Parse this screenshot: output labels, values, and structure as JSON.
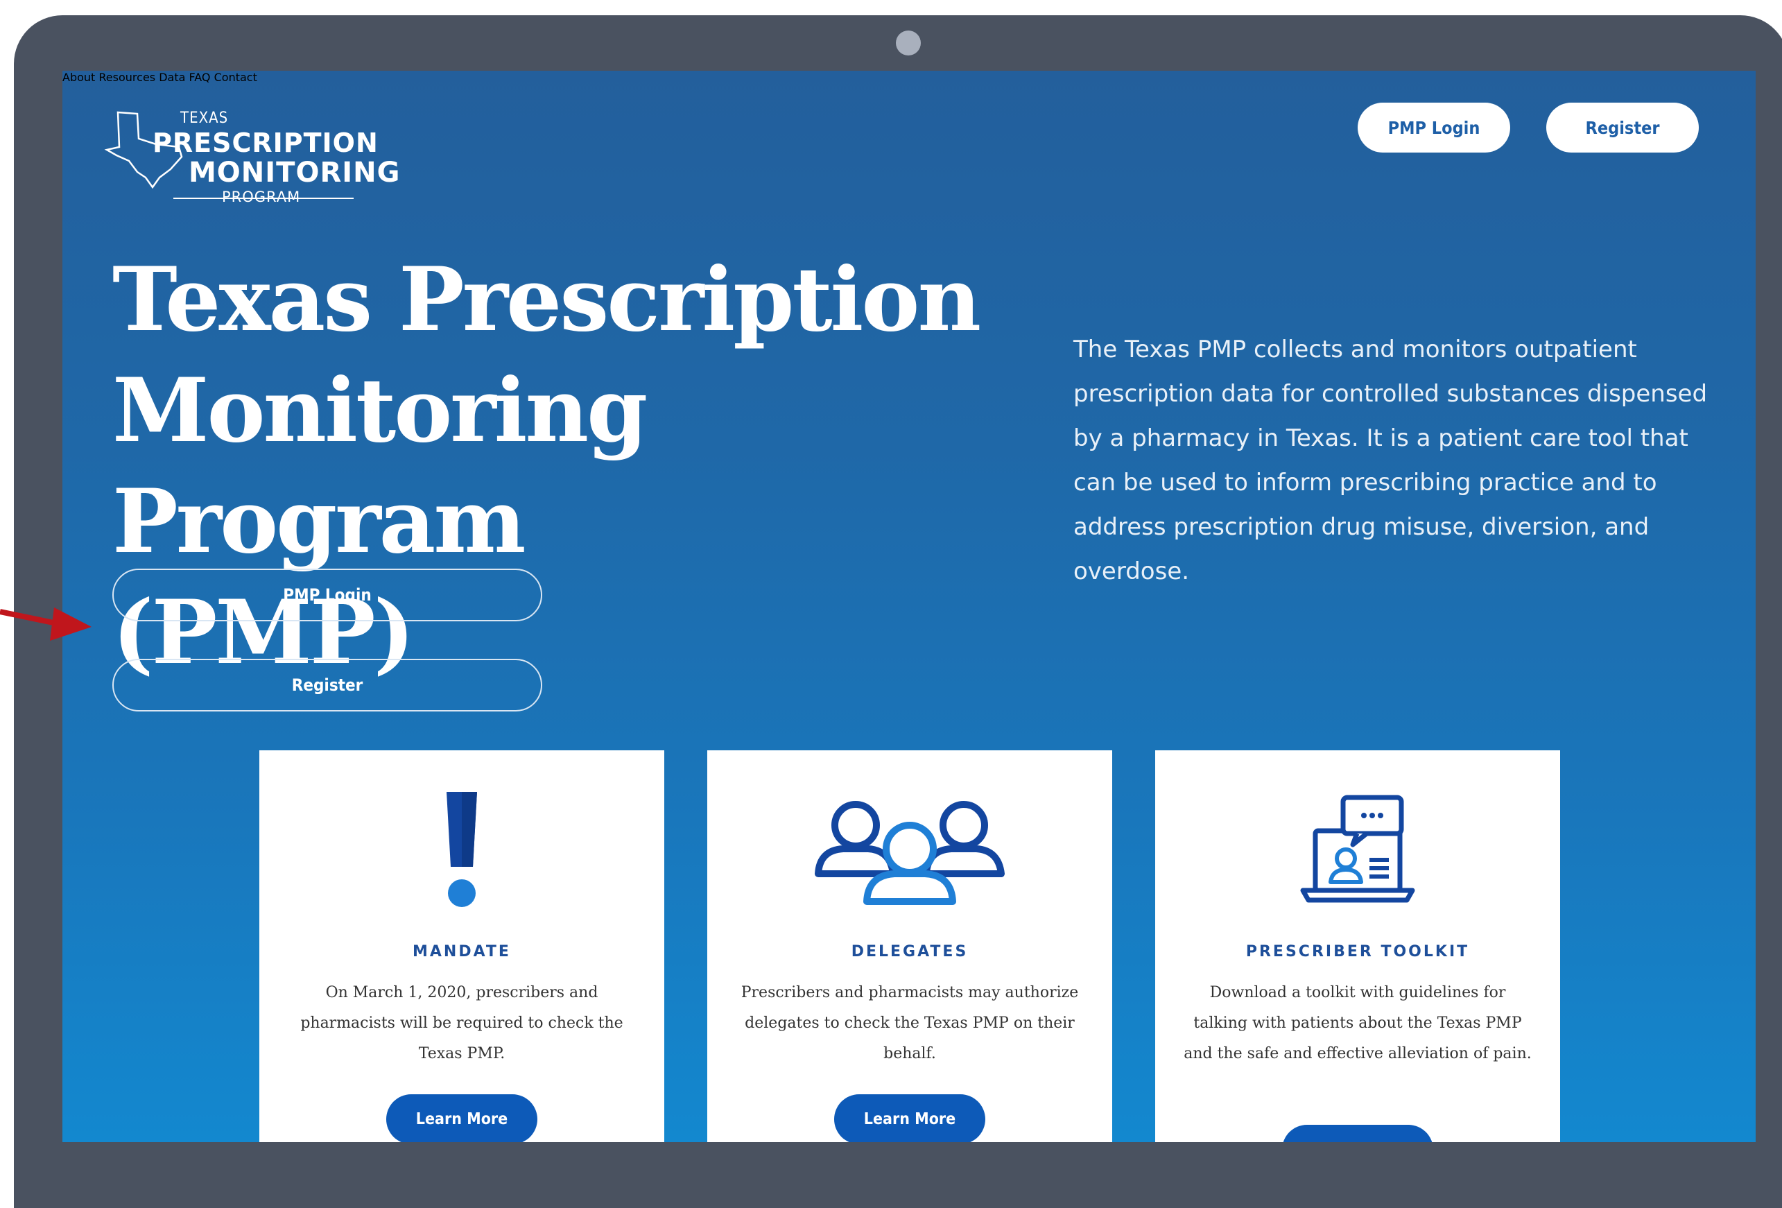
{
  "logo": {
    "line1": "TEXAS",
    "line2": "PRESCRIPTION",
    "line3": "MONITORING",
    "line4": "PROGRAM"
  },
  "nav": {
    "items": [
      "About",
      "Resources",
      "Data",
      "FAQ",
      "Contact"
    ],
    "login_button": "PMP Login",
    "register_button": "Register"
  },
  "hero": {
    "title_line1": "Texas Prescription",
    "title_line2": "Monitoring Program",
    "title_line3": "(PMP)",
    "description": "The Texas PMP collects and monitors outpatient prescription data for controlled substances dispensed by a pharmacy in Texas. It is a patient care tool that can be used to inform prescribing practice and to address prescription drug misuse, diversion, and overdose.",
    "login_button": "PMP Login",
    "register_button": "Register"
  },
  "cards": [
    {
      "icon": "exclamation-icon",
      "title": "MANDATE",
      "body": "On March 1, 2020, prescribers and pharmacists will be required to check the Texas PMP.",
      "button": "Learn More"
    },
    {
      "icon": "people-group-icon",
      "title": "DELEGATES",
      "body": "Prescribers and pharmacists may authorize delegates to check the Texas PMP on their behalf.",
      "button": "Learn More"
    },
    {
      "icon": "laptop-consultation-icon",
      "title": "PRESCRIBER TOOLKIT",
      "body": "Download a toolkit with guidelines for talking with patients about the Texas PMP and the safe and effective alleviation of pain.",
      "button": ""
    }
  ],
  "colors": {
    "frame": "#4a5260",
    "background_top": "#235f9c",
    "background_bottom": "#1388cf",
    "accent": "#0d5ab8",
    "annotation_arrow": "#c0161c"
  }
}
